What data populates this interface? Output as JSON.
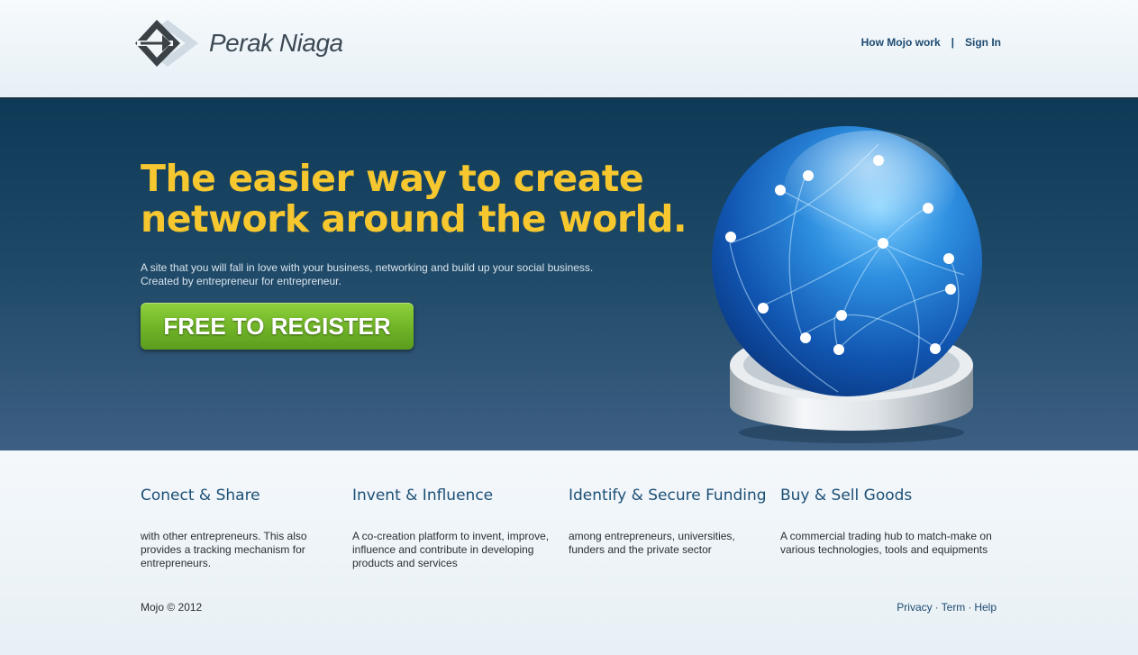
{
  "brand": {
    "name": "Perak Niaga"
  },
  "nav": {
    "how_it_works": "How Mojo work",
    "separator": "|",
    "sign_in": "Sign In"
  },
  "hero": {
    "headline_line1": "The easier way to create",
    "headline_line2": "network around the world.",
    "sub_line1": "A site that you will fall in love with your business, networking and build up your social business.",
    "sub_line2": "Created by entrepreneur for entrepreneur.",
    "cta": "FREE TO REGISTER"
  },
  "features": [
    {
      "title": "Conect & Share",
      "text": "with other entrepreneurs. This also provides a tracking mechanism for entrepreneurs."
    },
    {
      "title": "Invent & Influence",
      "text": "A co-creation platform to invent, improve, influence and contribute in developing products and services"
    },
    {
      "title": "Identify & Secure Funding",
      "text": "among entrepreneurs, universities, funders and the private sector"
    },
    {
      "title": "Buy & Sell Goods",
      "text": "A commercial trading hub to match-make on various technologies, tools and equipments"
    }
  ],
  "footer": {
    "copyright": "Mojo © 2012",
    "privacy": "Privacy",
    "term": "Term",
    "help": "Help",
    "dot": "·"
  },
  "colors": {
    "headline": "#f6c72e",
    "cta_green": "#6fb327",
    "link_blue": "#1d4a70",
    "hero_dark": "#0e3a57"
  }
}
